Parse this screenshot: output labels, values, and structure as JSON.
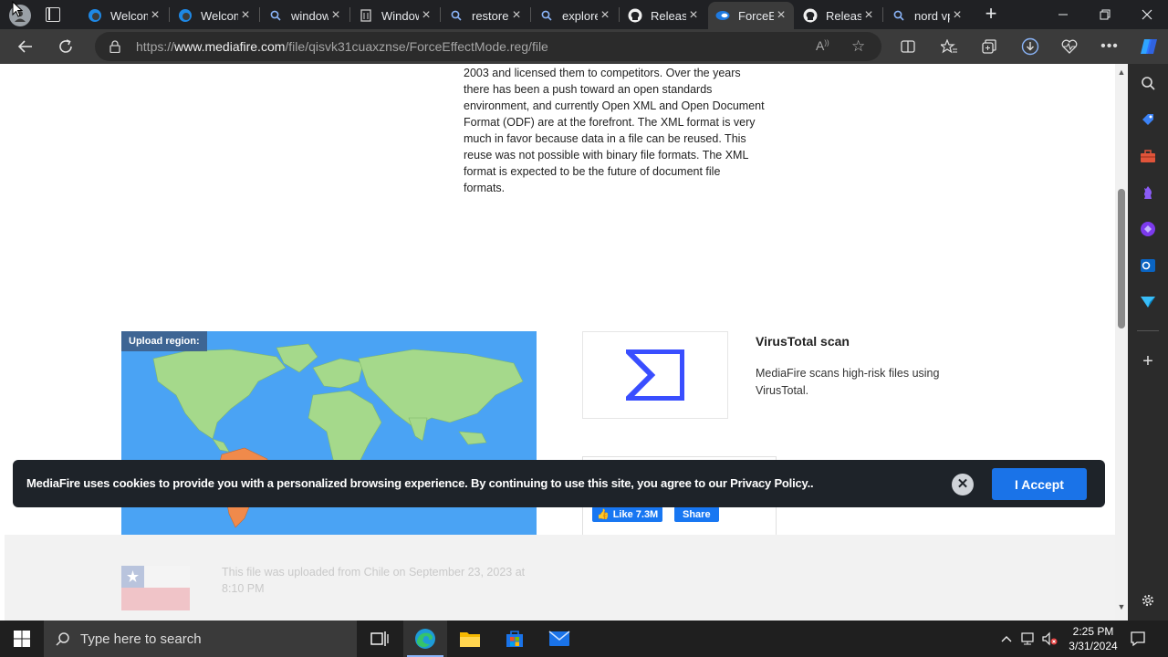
{
  "browser": {
    "tabs": [
      {
        "title": "Welcome",
        "icon": "edge-logo-icon",
        "active": false
      },
      {
        "title": "Welcome",
        "icon": "edge-logo-icon",
        "active": false
      },
      {
        "title": "windows",
        "icon": "search-icon",
        "active": false
      },
      {
        "title": "Windows",
        "icon": "document-icon",
        "active": false
      },
      {
        "title": "restore",
        "icon": "search-icon",
        "active": false
      },
      {
        "title": "explorer",
        "icon": "search-icon",
        "active": false
      },
      {
        "title": "Releases",
        "icon": "github-icon",
        "active": false
      },
      {
        "title": "ForceEffectMode",
        "icon": "mediafire-icon",
        "active": true
      },
      {
        "title": "Releases",
        "icon": "github-icon",
        "active": false
      },
      {
        "title": "nord vpn",
        "icon": "search-icon",
        "active": false
      }
    ],
    "url": {
      "scheme": "https://",
      "domain": "www.mediafire.com",
      "path": "/file/qisvk31cuaxznse/ForceEffectMode.reg/file"
    }
  },
  "page": {
    "article_text": "2003 and licensed them to competitors. Over the years there has been a push toward an open standards environment, and currently Open XML and Open Document Format (ODF) are at the forefront. The XML format is very much in favor because data in a file can be reused. This reuse was not possible with binary file formats. The XML format is expected to be the future of document file formats.",
    "upload_region_label": "Upload region:",
    "virustotal": {
      "title": "VirusTotal scan",
      "description": "MediaFire scans high-risk files using VirusTotal."
    },
    "facebook": {
      "like_label": "Like 7.3M",
      "share_label": "Share"
    },
    "upload_note": "This file was uploaded from Chile on September 23, 2023 at 8:10 PM"
  },
  "cookie_banner": {
    "message": "MediaFire uses cookies to provide you with a personalized browsing experience. By continuing to use this site, you agree to our Privacy Policy..",
    "close_symbol": "✕",
    "accept_label": "I Accept"
  },
  "taskbar": {
    "search_placeholder": "Type here to search",
    "time": "2:25 PM",
    "date": "3/31/2024"
  },
  "colors": {
    "ocean": "#4aa3f4",
    "land": "#a5d98b",
    "highlight_region": "#f08a4b",
    "accept_button": "#1a73e8",
    "cookie_bg": "#1e2329"
  }
}
